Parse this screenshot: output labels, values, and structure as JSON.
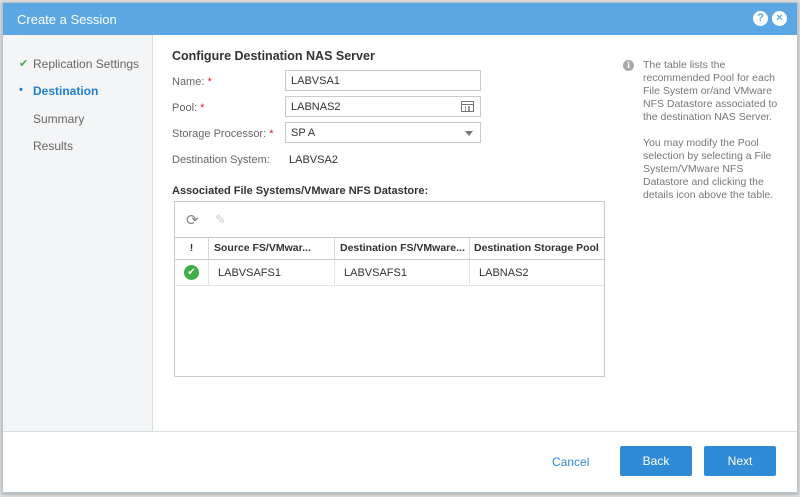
{
  "window": {
    "title": "Create a Session",
    "help_label": "?",
    "close_label": "×"
  },
  "steps": [
    {
      "label": "Replication Settings",
      "marker": "✔",
      "state": "done"
    },
    {
      "label": "Destination",
      "marker": "•",
      "state": "active"
    },
    {
      "label": "Summary",
      "marker": "",
      "state": "pending"
    },
    {
      "label": "Results",
      "marker": "",
      "state": "pending"
    }
  ],
  "form": {
    "section_title": "Configure Destination NAS Server",
    "required_mark": "*",
    "name": {
      "label": "Name:",
      "value": "LABVSA1"
    },
    "pool": {
      "label": "Pool:",
      "value": "LABNAS2"
    },
    "storage_processor": {
      "label": "Storage Processor:",
      "value": "SP A"
    },
    "destination_system": {
      "label": "Destination System:",
      "value": "LABVSA2"
    }
  },
  "table": {
    "title": "Associated File Systems/VMware NFS Datastore:",
    "toolbar": {
      "refresh_icon": "⟳",
      "edit_icon": "✎"
    },
    "columns": [
      "!",
      "Source FS/VMwar...",
      "Destination FS/VMware...",
      "Destination Storage Pool"
    ],
    "sort_icon": "↑",
    "rows": [
      {
        "status_icon": "✔",
        "source": "LABVSAFS1",
        "destination": "LABVSAFS1",
        "pool": "LABNAS2"
      }
    ]
  },
  "info": {
    "icon": "i",
    "paragraph1": "The table lists the recommended Pool for each File System or/and VMware NFS Datastore associated to the destination NAS Server.",
    "paragraph2": "You may modify the Pool selection by selecting a File System/VMware NFS Datastore and clicking the details icon above the table."
  },
  "footer": {
    "cancel_label": "Cancel",
    "back_label": "Back",
    "next_label": "Next"
  },
  "colors": {
    "titlebar": "#5aa7e3",
    "accent": "#2f8ad8",
    "success": "#3fae49",
    "required": "#d9232e"
  }
}
